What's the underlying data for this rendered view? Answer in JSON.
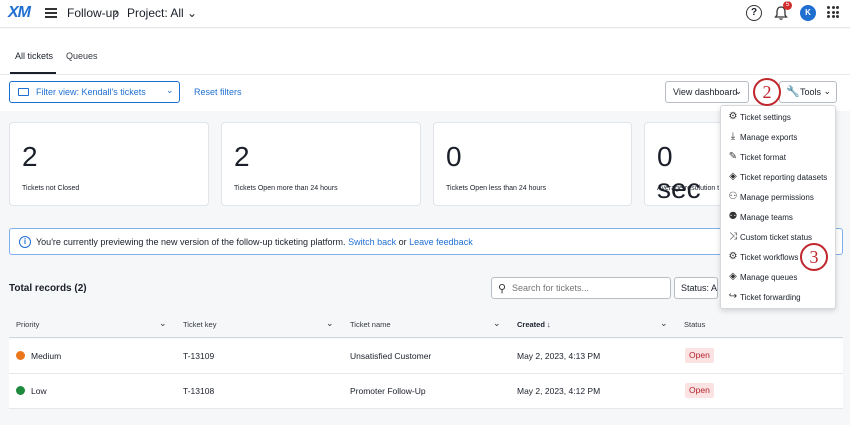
{
  "topbar": {
    "logo": "XM",
    "app": "Follow-up",
    "separator": "›",
    "project": "Project: All",
    "help": "?",
    "notifications": "5",
    "avatar_initial": "K"
  },
  "tabs": [
    {
      "label": "All tickets",
      "active": true
    },
    {
      "label": "Queues",
      "active": false
    }
  ],
  "filterbar": {
    "filter_view": "Filter view: Kendall's tickets",
    "reset": "Reset filters",
    "view_dashboard": "View dashboard",
    "tools": "Tools"
  },
  "stats": [
    {
      "value": "2",
      "label": "Tickets not Closed"
    },
    {
      "value": "2",
      "label": "Tickets Open more than 24 hours"
    },
    {
      "value": "0",
      "label": "Tickets Open less than 24 hours"
    },
    {
      "value": "0 sec",
      "label": "Average resolution t"
    }
  ],
  "banner": {
    "text": "You're currently previewing the new version of the follow-up ticketing platform.",
    "switch_back": "Switch back",
    "or": "or",
    "leave_feedback": "Leave feedback"
  },
  "records": {
    "total": "Total records (2)",
    "search_placeholder": "Search for tickets...",
    "status_filter": "Status: Act"
  },
  "table": {
    "columns": [
      "Priority",
      "Ticket key",
      "Ticket name",
      "Created",
      "Status"
    ],
    "rows": [
      {
        "priority": "Medium",
        "priority_color": "#e8771e",
        "key": "T-13109",
        "name": "Unsatisfied Customer",
        "created": "May 2, 2023, 4:13 PM",
        "status": "Open"
      },
      {
        "priority": "Low",
        "priority_color": "#1e8a3e",
        "key": "T-13108",
        "name": "Promoter Follow-Up",
        "created": "May 2, 2023, 4:12 PM",
        "status": "Open"
      }
    ]
  },
  "tools_menu": [
    {
      "icon": "gear-icon",
      "label": "Ticket settings"
    },
    {
      "icon": "download-icon",
      "label": "Manage exports"
    },
    {
      "icon": "pencil-icon",
      "label": "Ticket format"
    },
    {
      "icon": "tag-icon",
      "label": "Ticket reporting datasets"
    },
    {
      "icon": "users-icon",
      "label": "Manage permissions"
    },
    {
      "icon": "team-icon",
      "label": "Manage teams"
    },
    {
      "icon": "shuffle-icon",
      "label": "Custom ticket status"
    },
    {
      "icon": "gears-icon",
      "label": "Ticket workflows"
    },
    {
      "icon": "tags-icon",
      "label": "Manage queues"
    },
    {
      "icon": "forward-icon",
      "label": "Ticket forwarding"
    }
  ],
  "callouts": [
    "2",
    "3"
  ],
  "colors": {
    "accent": "#1f6fd1",
    "callout": "#c0272d",
    "status_open_bg": "#fbe3e3"
  }
}
